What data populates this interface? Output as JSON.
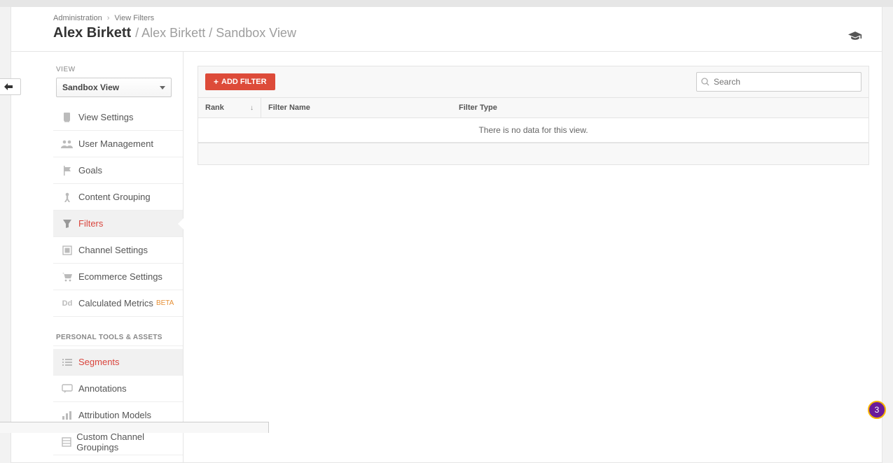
{
  "breadcrumb": {
    "a": "Administration",
    "b": "View Filters"
  },
  "title": {
    "main": "Alex Birkett",
    "path": " / Alex Birkett / Sandbox View"
  },
  "view": {
    "heading": "VIEW",
    "selected": "Sandbox View"
  },
  "menu": [
    {
      "icon": "settings",
      "label": "View Settings"
    },
    {
      "icon": "users",
      "label": "User Management"
    },
    {
      "icon": "flag",
      "label": "Goals"
    },
    {
      "icon": "group",
      "label": "Content Grouping"
    },
    {
      "icon": "funnel",
      "label": "Filters",
      "activeMain": true
    },
    {
      "icon": "channel",
      "label": "Channel Settings"
    },
    {
      "icon": "cart",
      "label": "Ecommerce Settings"
    },
    {
      "icon": "dd",
      "label": "Calculated Metrics",
      "badge": "BETA"
    }
  ],
  "section2_title": "PERSONAL TOOLS & ASSETS",
  "menu2": [
    {
      "icon": "segments",
      "label": "Segments",
      "accent": true
    },
    {
      "icon": "annot",
      "label": "Annotations"
    },
    {
      "icon": "bars",
      "label": "Attribution Models"
    },
    {
      "icon": "custom",
      "label": "Custom Channel Groupings"
    }
  ],
  "toolbar": {
    "add_label": "ADD FILTER",
    "search_placeholder": "Search"
  },
  "table": {
    "h_rank": "Rank",
    "h_name": "Filter Name",
    "h_type": "Filter Type",
    "empty_msg": "There is no data for this view."
  },
  "fab_label": "3"
}
